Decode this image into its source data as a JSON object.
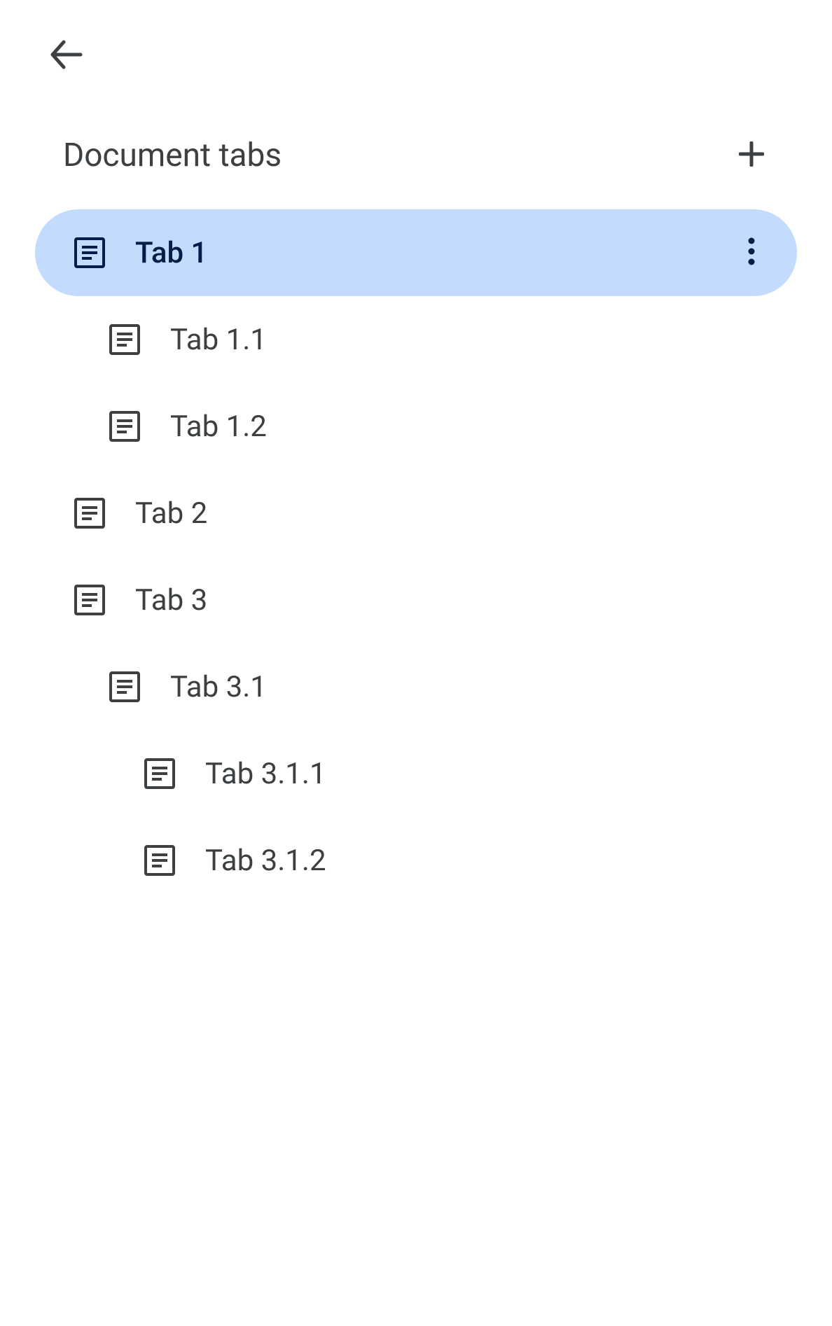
{
  "header": {
    "title": "Document tabs"
  },
  "tabs": [
    {
      "label": "Tab 1",
      "indent": 0,
      "selected": true
    },
    {
      "label": "Tab 1.1",
      "indent": 1,
      "selected": false
    },
    {
      "label": "Tab 1.2",
      "indent": 1,
      "selected": false
    },
    {
      "label": "Tab 2",
      "indent": 0,
      "selected": false
    },
    {
      "label": "Tab 3",
      "indent": 0,
      "selected": false
    },
    {
      "label": "Tab 3.1",
      "indent": 1,
      "selected": false
    },
    {
      "label": "Tab 3.1.1",
      "indent": 2,
      "selected": false
    },
    {
      "label": "Tab 3.1.2",
      "indent": 2,
      "selected": false
    }
  ],
  "colors": {
    "selected_bg": "#c3dbfc",
    "text": "#3c4043",
    "selected_text": "#041e49"
  }
}
